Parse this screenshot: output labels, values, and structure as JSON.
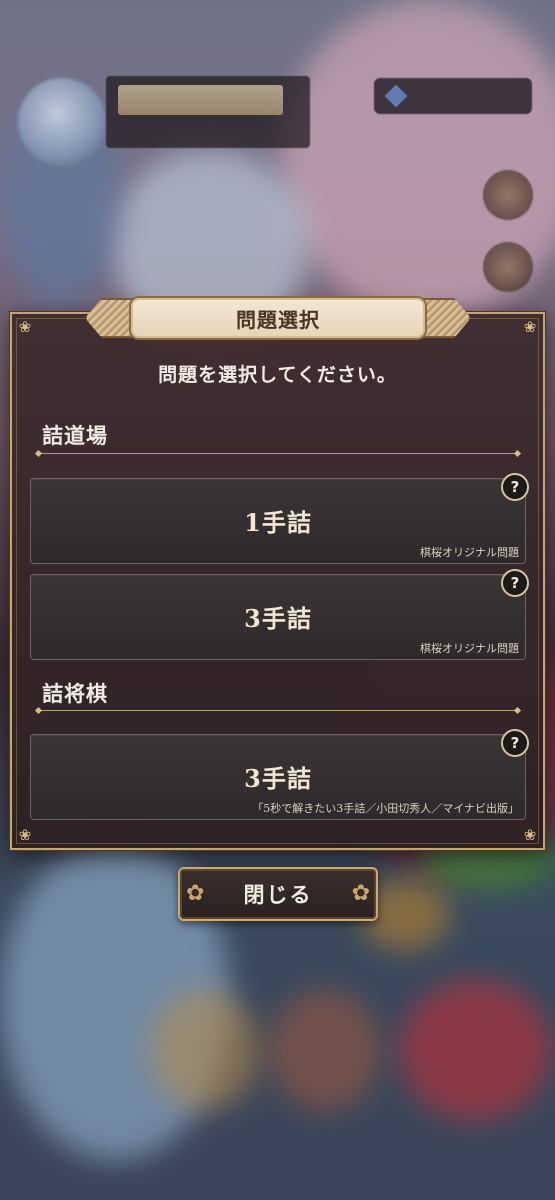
{
  "dialog": {
    "title": "問題選択",
    "instruction": "問題を選択してください。",
    "sections": [
      {
        "title": "詰道場",
        "options": [
          {
            "label": "1手詰",
            "source": "棋桜オリジナル問題",
            "help": "?"
          },
          {
            "label": "3手詰",
            "source": "棋桜オリジナル問題",
            "help": "?"
          }
        ]
      },
      {
        "title": "詰将棋",
        "options": [
          {
            "label": "3手詰",
            "source": "「5秒で解きたい3手詰／小田切秀人／マイナビ出版」",
            "help": "?"
          }
        ]
      }
    ],
    "close_label": "閉じる"
  },
  "icons": {
    "corner": "sakura-icon",
    "help": "question-mark-icon",
    "close_decoration": "sakura-icon"
  },
  "colors": {
    "gold_border": "#c5a771",
    "panel": "#2e2124",
    "header_plate": "#efe1ca",
    "text_light": "#f2ece4"
  }
}
